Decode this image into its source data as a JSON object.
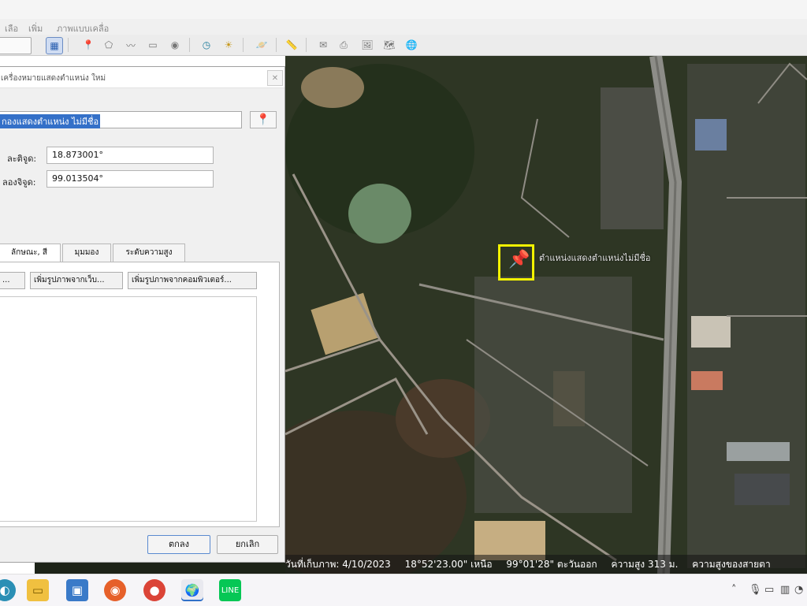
{
  "menu": {
    "items": [
      "เลือ",
      "เพิ่ม",
      "ภาพแบบเคลื่อ"
    ]
  },
  "toolbar": {
    "buttons": [
      "sidebar-toggle",
      "add-placemark",
      "add-polygon",
      "add-path",
      "add-image-overlay",
      "record-tour",
      "show-historical-imagery",
      "show-sunlight",
      "switch-to-sky",
      "show-ruler",
      "email",
      "print",
      "save-image",
      "view-in-maps",
      "earth"
    ]
  },
  "dialog": {
    "title": "เครื่องหมายแสดงตำแหน่ง ใหม่",
    "close_label": "✕",
    "name_value": "กองแสดงตำแหน่ง ไม่มีชื่อ",
    "latitude_label": "ละติจูด:",
    "latitude_value": "18.873001°",
    "longitude_label": "ลองจิจูด:",
    "longitude_value": "99.013504°",
    "tabs": [
      "ลักษณะ, สี",
      "มุมมอง",
      "ระดับความสูง"
    ],
    "panel_buttons": [
      "...",
      "เพิ่มรูปภาพจากเว็บ...",
      "เพิ่มรูปภาพจากคอมพิวเตอร์..."
    ],
    "ok_label": "ตกลง",
    "cancel_label": "ยกเลิก"
  },
  "map": {
    "placemark_label": "ตำแหน่งแสดงตำแหน่งไม่มีชื่อ",
    "status": {
      "imagery_date": "วันที่เก็บภาพ: 4/10/2023",
      "lat": "18°52'23.00\" เหนือ",
      "lon": "99°01'28\" ตะวันออก",
      "elev": "ความสูง 313 ม.",
      "eye": "ความสูงของสายตา"
    }
  },
  "taskbar": {
    "apps": [
      "chrome-canary",
      "file-explorer",
      "app-store",
      "firefox",
      "chrome",
      "google-earth",
      "line"
    ]
  },
  "colors": {
    "accent": "#3470c8",
    "placemark": "#f2f200",
    "dialog_bg": "#f0f0f0"
  }
}
